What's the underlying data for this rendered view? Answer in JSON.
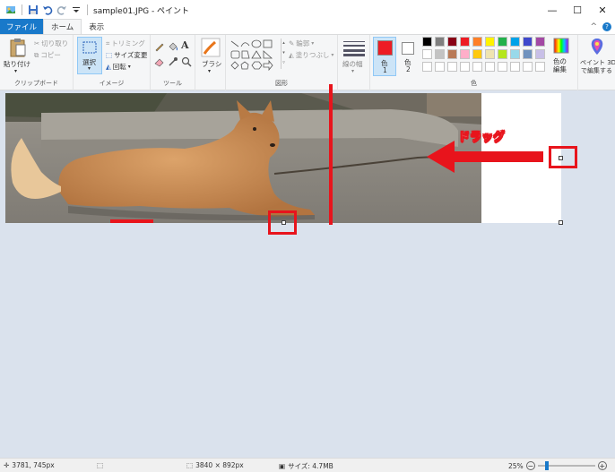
{
  "window": {
    "title": "sample01.JPG - ペイント",
    "minimize": "—",
    "maximize": "☐",
    "close": "✕"
  },
  "tabs": {
    "file": "ファイル",
    "home": "ホーム",
    "view": "表示",
    "collapse": "^",
    "help": "?"
  },
  "ribbon": {
    "clipboard": {
      "paste": "貼り付け",
      "cut": "切り取り",
      "copy": "コピー",
      "label": "クリップボード"
    },
    "image": {
      "select": "選択",
      "crop": "トリミング",
      "resize": "サイズ変更",
      "rotate": "回転",
      "label": "イメージ"
    },
    "tools": {
      "label": "ツール"
    },
    "brushes": {
      "label": "ブラシ"
    },
    "shapes": {
      "outline": "輪郭",
      "fill": "塗りつぶし",
      "label": "図形"
    },
    "size": {
      "label": "線の幅"
    },
    "colors": {
      "color1": "色\n1",
      "color1_label": "色",
      "color1_num": "1",
      "color2_label": "色",
      "color2_num": "2",
      "edit": "色の\n編集",
      "edit_line1": "色の",
      "edit_line2": "編集",
      "label": "色",
      "color1_value": "#ed1c24",
      "color2_value": "#ffffff",
      "palette": [
        "#000000",
        "#7f7f7f",
        "#880015",
        "#ed1c24",
        "#ff7f27",
        "#fff200",
        "#22b14c",
        "#00a2e8",
        "#3f48cc",
        "#a349a4",
        "#ffffff",
        "#c3c3c3",
        "#b97a57",
        "#ffaec9",
        "#ffc90e",
        "#efe4b0",
        "#b5e61d",
        "#99d9ea",
        "#7092be",
        "#c8bfe7"
      ]
    },
    "paint3d": {
      "line1": "ペイント 3D",
      "line2": "で編集する"
    }
  },
  "annotation": {
    "drag_label": "ドラッグ",
    "accent": "#e8141c"
  },
  "status": {
    "cursor_pos": "3781, 745px",
    "image_size": "3840 × 892px",
    "file_size": "サイズ: 4.7MB",
    "zoom": "25%",
    "zoom_percent": 25
  }
}
